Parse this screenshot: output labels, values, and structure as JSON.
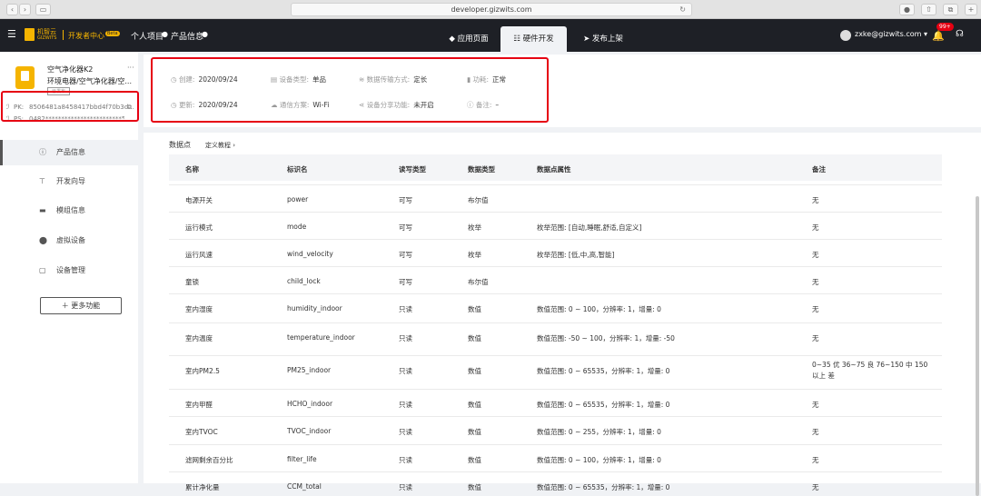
{
  "browser": {
    "url": "developer.gizwits.com"
  },
  "topnav": {
    "brand": "机智云",
    "brand_sub": "GIZWITS",
    "dev_center": "开发者中心",
    "badge": "Beta",
    "personal": "个人项目",
    "product_info": "产品信息",
    "tabs": [
      "应用页面",
      "硬件开发",
      "发布上架"
    ],
    "user": "zxke@gizwits.com ▾",
    "notify_count": "99+"
  },
  "product": {
    "name": "空气净化器K2",
    "category": "环境电器/空气净化器/空...",
    "tag": "已发布",
    "more": "···",
    "pk_label": "PK:",
    "pk": "8506481a8458417bbd4f70b3d...",
    "ps_label": "PS:",
    "ps": "0482************************5e0a"
  },
  "sidebar": {
    "items": [
      {
        "label": "产品信息",
        "icon": "ⓘ"
      },
      {
        "label": "开发向导",
        "icon": "⊤"
      },
      {
        "label": "模组信息",
        "icon": "▬"
      },
      {
        "label": "虚拟设备",
        "icon": "⬤"
      },
      {
        "label": "设备管理",
        "icon": "▢"
      }
    ],
    "more_button": "＋ 更多功能"
  },
  "info": {
    "created_label": "创建:",
    "created": "2020/09/24",
    "updated_label": "更新:",
    "updated": "2020/09/24",
    "device_type_label": "设备类型:",
    "device_type": "单品",
    "comm_label": "通信方案:",
    "comm": "Wi-Fi",
    "transfer_label": "数据传输方式:",
    "transfer": "定长",
    "share_label": "设备分享功能:",
    "share": "未开启",
    "power_label": "功耗:",
    "power": "正常",
    "note_label": "备注:",
    "note": "–"
  },
  "table": {
    "title": "数据点",
    "tutorial": "定义教程 ›",
    "headers": [
      "名称",
      "标识名",
      "读写类型",
      "数据类型",
      "数据点属性",
      "备注"
    ],
    "rows": [
      [
        "电源开关",
        "power",
        "可写",
        "布尔值",
        "",
        "无"
      ],
      [
        "运行模式",
        "mode",
        "可写",
        "枚举",
        "枚举范围: [自动,睡眠,舒适,自定义]",
        "无"
      ],
      [
        "运行风速",
        "wind_velocity",
        "可写",
        "枚举",
        "枚举范围: [低,中,高,智能]",
        "无"
      ],
      [
        "童锁",
        "child_lock",
        "可写",
        "布尔值",
        "",
        "无"
      ],
      [
        "室内湿度",
        "humidity_indoor",
        "只读",
        "数值",
        "数值范围: 0 ~ 100，分辨率: 1，增量: 0",
        "无"
      ],
      [
        "室内温度",
        "temperature_indoor",
        "只读",
        "数值",
        "数值范围: -50 ~ 100，分辨率: 1，增量: -50",
        "无"
      ],
      [
        "室内PM2.5",
        "PM25_indoor",
        "只读",
        "数值",
        "数值范围: 0 ~ 65535，分辨率: 1，增量: 0",
        "0~35 优 36~75 良 76~150 中 150"
      ],
      [
        "室内甲醛",
        "HCHO_indoor",
        "只读",
        "数值",
        "数值范围: 0 ~ 65535，分辨率: 1，增量: 0",
        "无"
      ],
      [
        "室内TVOC",
        "TVOC_indoor",
        "只读",
        "数值",
        "数值范围: 0 ~ 255，分辨率: 1，增量: 0",
        "无"
      ],
      [
        "滤网剩余百分比",
        "filter_life",
        "只读",
        "数值",
        "数值范围: 0 ~ 100，分辨率: 1，增量: 0",
        "无"
      ],
      [
        "累计净化量",
        "CCM_total",
        "只读",
        "数值",
        "数值范围: 0 ~ 65535，分辨率: 1，增量: 0",
        "无"
      ]
    ],
    "pm25_note_line2": "以上 差"
  }
}
